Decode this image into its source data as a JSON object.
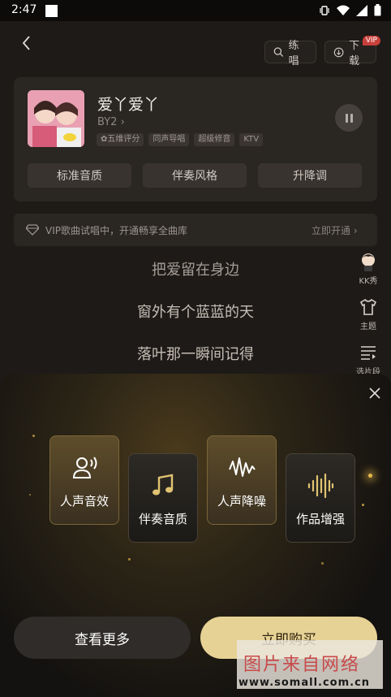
{
  "status_bar": {
    "time": "2:47"
  },
  "nav": {
    "practice_label": "练唱",
    "download_label": "下载",
    "vip_badge": "VIP"
  },
  "song": {
    "title": "爱丫爱丫",
    "artist": "BY2",
    "tags": [
      "✿五维评分",
      "同声导唱",
      "超级修音",
      "KTV"
    ]
  },
  "options": [
    "标准音质",
    "伴奏风格",
    "升降调"
  ],
  "vip_banner": {
    "text": "VIP歌曲试唱中，开通畅享全曲库",
    "action": "立即开通"
  },
  "lyrics": [
    "把爱留在身边",
    "窗外有个蓝蓝的天",
    "落叶那一瞬间记得"
  ],
  "side_tools": [
    {
      "label": "KK秀",
      "icon": "avatar-icon"
    },
    {
      "label": "主题",
      "icon": "shirt-icon"
    },
    {
      "label": "选片段",
      "icon": "segment-icon"
    }
  ],
  "features": [
    {
      "label": "人声音效",
      "icon": "voice-effect-icon",
      "style": "gold"
    },
    {
      "label": "伴奏音质",
      "icon": "music-note-icon",
      "style": "dark"
    },
    {
      "label": "人声降噪",
      "icon": "noise-reduction-icon",
      "style": "gold"
    },
    {
      "label": "作品增强",
      "icon": "waveform-icon",
      "style": "dark"
    }
  ],
  "buttons": {
    "more": "查看更多",
    "buy": "立即购买"
  },
  "watermark": {
    "text": "图片来自网络",
    "url": "www.somall.com.cn"
  },
  "colors": {
    "accent_gold": "#e7d295",
    "vip_red": "#c9403b",
    "background": "#1e1a17"
  }
}
